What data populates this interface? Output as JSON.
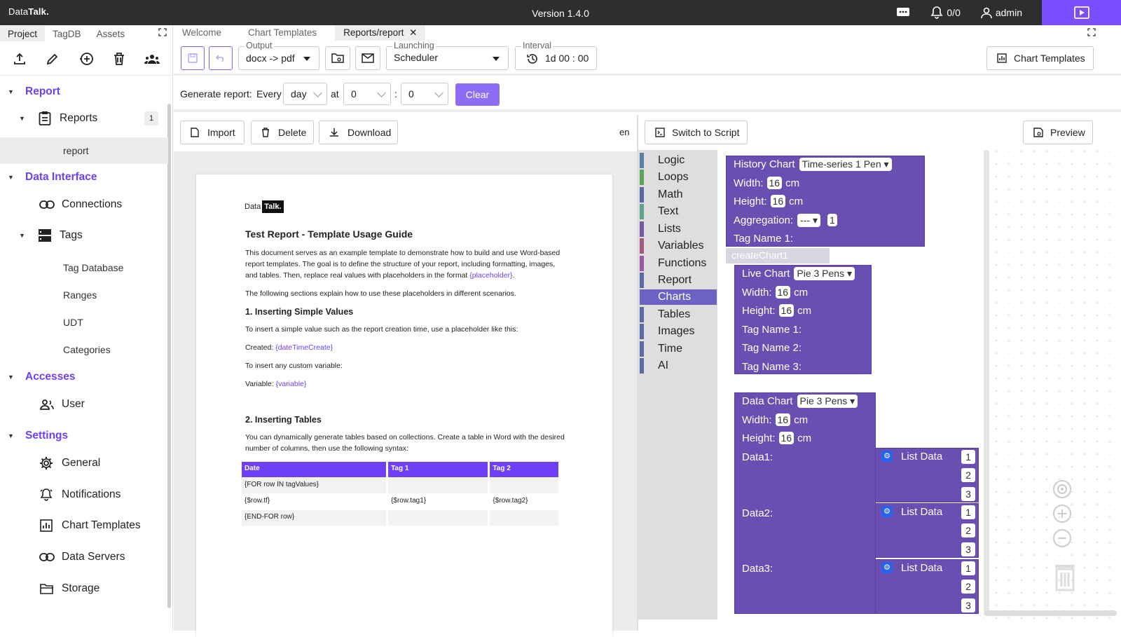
{
  "topbar": {
    "logo_prefix": "Data",
    "logo_bold": "Talk.",
    "version": "Version 1.4.0",
    "alarms": "0/0",
    "user": "admin"
  },
  "left_tabs": [
    "Project",
    "TagDB",
    "Assets"
  ],
  "tree": {
    "report": "Report",
    "reports": "Reports",
    "reports_count": "1",
    "report_item": "report",
    "data_interface": "Data Interface",
    "connections": "Connections",
    "tags": "Tags",
    "tag_database": "Tag Database",
    "ranges": "Ranges",
    "udt": "UDT",
    "categories": "Categories",
    "accesses": "Accesses",
    "user": "User",
    "settings": "Settings",
    "general": "General",
    "notifications": "Notifications",
    "chart_templates": "Chart Templates",
    "data_servers": "Data Servers",
    "storage": "Storage"
  },
  "tabs": [
    "Welcome",
    "Chart Templates",
    "Reports/report"
  ],
  "toolbar": {
    "output_label": "Output",
    "output_value": "docx -> pdf",
    "launching_label": "Launching",
    "launching_value": "Scheduler",
    "interval_label": "Interval",
    "interval_value": "1d 00 : 00",
    "chart_templates_btn": "Chart Templates"
  },
  "generate": {
    "label": "Generate report:",
    "every": "Every",
    "period": "day",
    "at": "at",
    "hour": "0",
    "colon": ":",
    "minute": "0",
    "clear": "Clear"
  },
  "actions": {
    "import": "Import",
    "delete": "Delete",
    "download": "Download",
    "lang": "en",
    "switch_script": "Switch to Script",
    "preview": "Preview"
  },
  "doc": {
    "logo_a": "Data",
    "logo_b": "Talk.",
    "title": "Test Report - Template Usage Guide",
    "p1": "This document serves as an example template to demonstrate how to build and use Word-based report templates. The goal is to define the structure of your report, including formatting, images, and tables. Then, replace real values with placeholders in the format ",
    "p1_ph": "{placeholder}",
    "p1_end": ".",
    "p2": "The following sections explain how to use these placeholders in different scenarios.",
    "h1": "1. Inserting Simple Values",
    "p3": "To insert a simple value such as the report creation time, use a placeholder like this:",
    "created": "Created: ",
    "created_ph": "{dateTimeCreate}",
    "p4": "To insert any custom variable:",
    "variable": "Variable: ",
    "variable_ph": "{variable}",
    "h2": "2. Inserting Tables",
    "p5": "You can dynamically generate tables based on collections. Create a table in Word with the desired number of columns, then use the following syntax:",
    "table_head": [
      "Date",
      "Tag 1",
      "Tag 2"
    ],
    "rows": [
      [
        "{FOR row IN tagValues}",
        "",
        ""
      ],
      [
        "{$row.tf}",
        "{$row.tag1}",
        "{$row.tag2}"
      ],
      [
        "{END-FOR row}",
        "",
        ""
      ]
    ]
  },
  "toolbox": [
    "Logic",
    "Loops",
    "Math",
    "Text",
    "Lists",
    "Variables",
    "Functions",
    "Report",
    "Charts",
    "Tables",
    "Images",
    "Time",
    "AI"
  ],
  "toolbox_colors": [
    "#5b80a5",
    "#5ba55b",
    "#5b67a5",
    "#5ba58c",
    "#745ba5",
    "#a55b80",
    "#995ba5",
    "#5b6ba5",
    "#6b62c4",
    "#5b6ba5",
    "#5b6ba5",
    "#5b6ba5",
    "#5b6ba5"
  ],
  "blocks": {
    "history_title": "History Chart",
    "history_type": "Time-series 1 Pen",
    "width": "Width:",
    "height": "Height:",
    "val16": "16",
    "cm": "cm",
    "aggregation": "Aggregation:",
    "agg_value": "---",
    "agg_num": "1",
    "tag1": "Tag Name 1:",
    "tag2": "Tag Name 2:",
    "tag3": "Tag Name 3:",
    "create_chart": "createChart1",
    "live_title": "Live Chart",
    "live_type": "Pie 3 Pens",
    "data_title": "Data Chart",
    "data_type": "Pie 3 Pens",
    "data1": "Data1:",
    "data2": "Data2:",
    "data3": "Data3:",
    "list_data": "List Data",
    "n1": "1",
    "n2": "2",
    "n3": "3"
  }
}
